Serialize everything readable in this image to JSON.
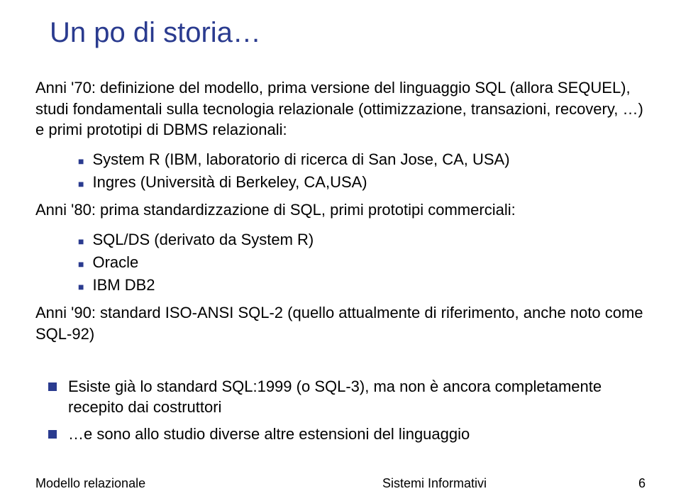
{
  "title": "Un po di storia…",
  "p70_intro": "Anni '70: definizione del modello, prima versione del linguaggio SQL (allora SEQUEL), studi fondamentali sulla tecnologia relazionale (ottimizzazione, transazioni, recovery, …) e primi prototipi di DBMS relazionali:",
  "p70_items": [
    "System R (IBM, laboratorio di ricerca di San Jose, CA, USA)",
    "Ingres (Università di Berkeley, CA,USA)"
  ],
  "p80_intro": "Anni '80: prima standardizzazione di SQL, primi prototipi commerciali:",
  "p80_items": [
    "SQL/DS (derivato da System R)",
    "Oracle",
    "IBM DB2"
  ],
  "p90": "Anni '90: standard ISO-ANSI SQL-2 (quello attualmente di riferimento, anche noto come SQL-92)",
  "closing": [
    "Esiste già lo standard SQL:1999 (o SQL-3), ma non è ancora completamente recepito dai costruttori",
    "…e sono allo studio diverse altre estensioni del linguaggio"
  ],
  "footer": {
    "left": "Modello relazionale",
    "center": "Sistemi Informativi",
    "right": "6"
  }
}
